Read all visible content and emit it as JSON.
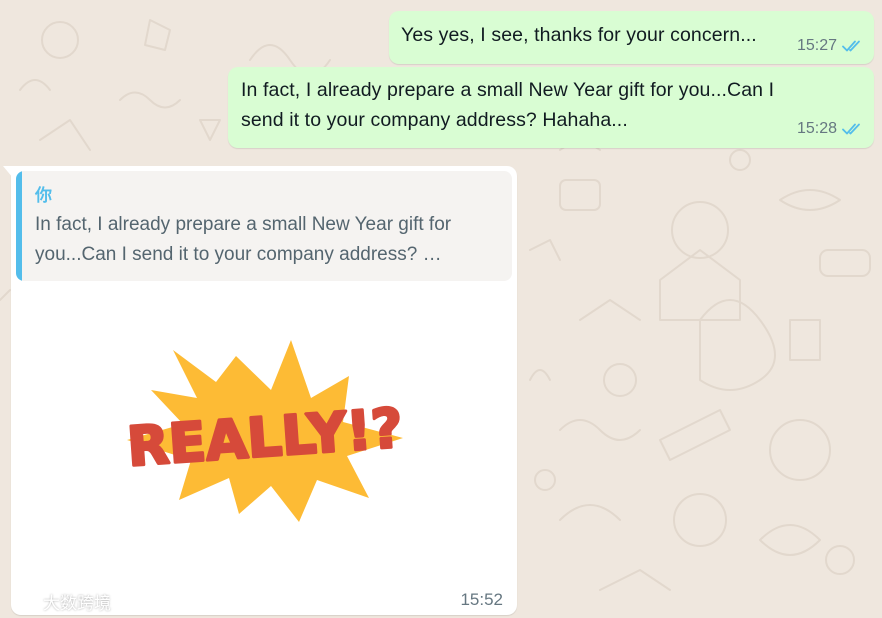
{
  "colors": {
    "wallpaper": "#efe7de",
    "outgoing_bubble": "#d9fdd3",
    "incoming_bubble": "#ffffff",
    "quote_accent": "#53bdeb",
    "read_ticks": "#53bdeb",
    "sticker_burst": "#fdbb35",
    "sticker_text": "#d64a3a"
  },
  "messages": [
    {
      "direction": "outgoing",
      "text": "Yes yes, I see, thanks for your concern...",
      "time": "15:27",
      "status_icon": "double-check-read-icon"
    },
    {
      "direction": "outgoing",
      "text": "In fact, I already prepare a small New Year gift for you...Can I send it to your company address?   Hahaha...",
      "time": "15:28",
      "status_icon": "double-check-read-icon"
    },
    {
      "direction": "incoming",
      "quote": {
        "author": "你",
        "text": "In fact, I already prepare a small New Year gift for you...Can I send it to your company address?   …"
      },
      "sticker": {
        "text": "REALLY!?",
        "icon": "really-sticker"
      },
      "time": "15:52"
    }
  ],
  "watermark": {
    "text": "大数跨境",
    "icon": "brand-logo-icon"
  }
}
